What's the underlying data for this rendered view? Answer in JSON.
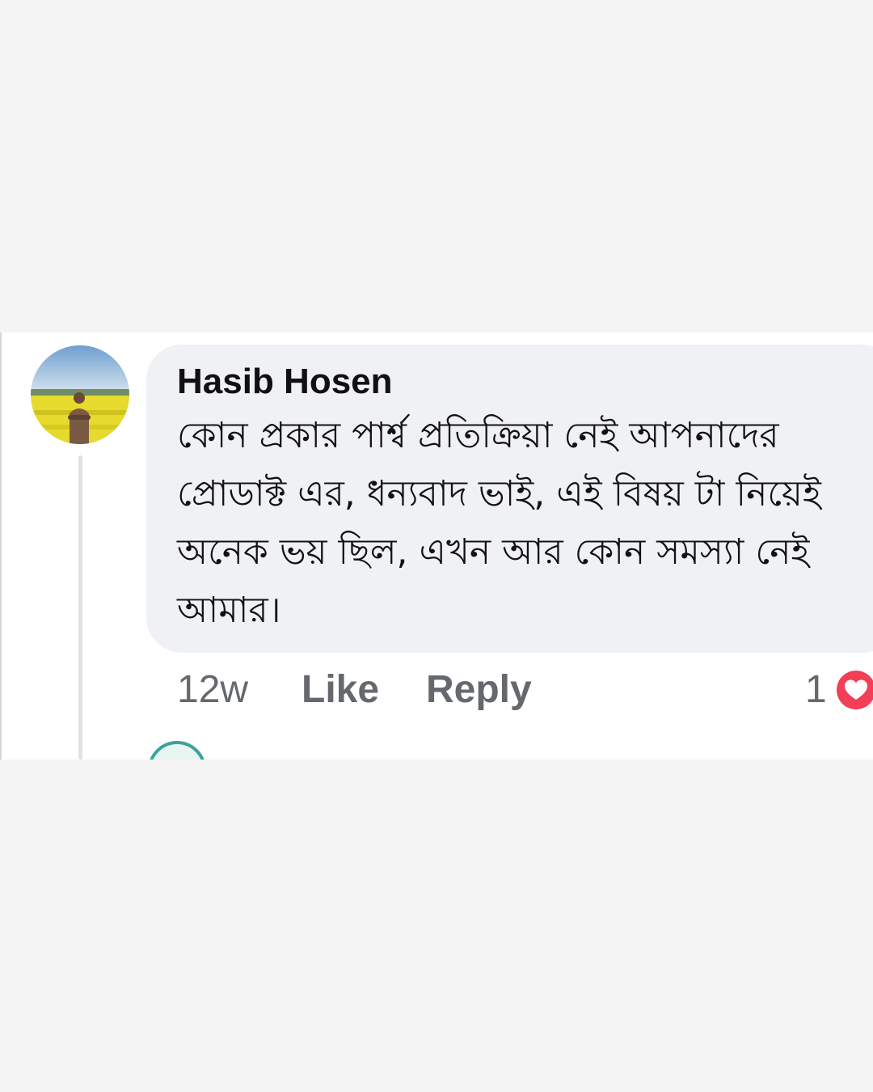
{
  "comment": {
    "author": "Hasib Hosen",
    "text": "কোন প্রকার পার্শ্ব প্রতিক্রিয়া নেই আপনাদের প্রোডাক্ট এর, ধন্যবাদ ভাই, এই বিষয় টা নিয়েই অনেক ভয় ছিল, এখন আর কোন সমস্যা নেই আমার।",
    "timestamp": "12w",
    "like_label": "Like",
    "reply_label": "Reply",
    "reaction_count": "1",
    "reaction_icon": "heart-icon"
  },
  "colors": {
    "page_background": "#f4f4f4",
    "card_background": "#ffffff",
    "bubble_background": "#f0f1f5",
    "action_text": "#65686d",
    "reaction_red": "#f33e58"
  }
}
